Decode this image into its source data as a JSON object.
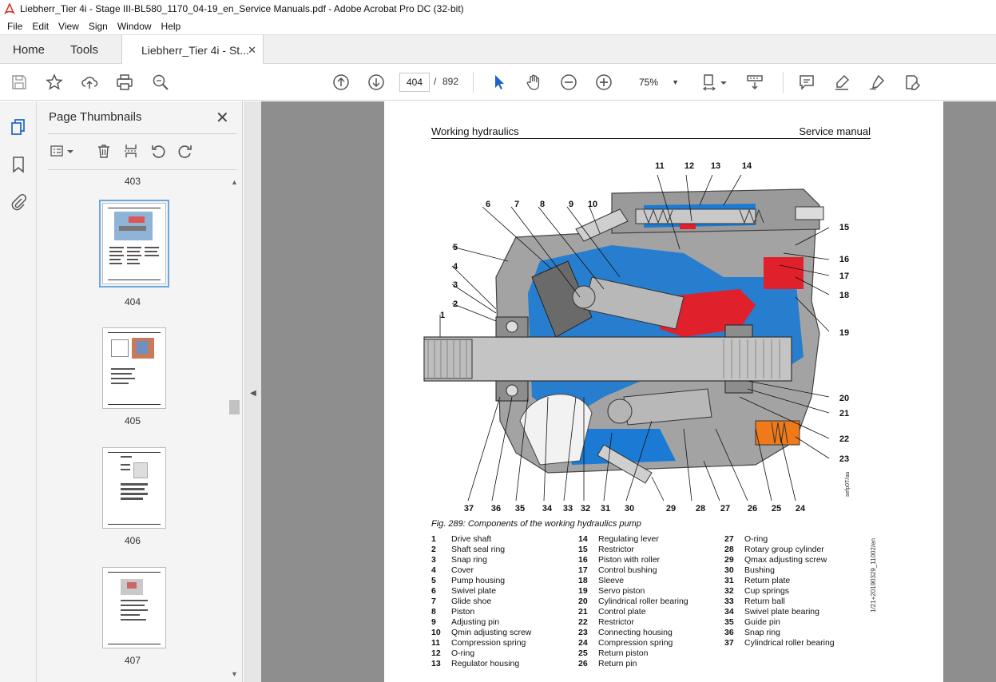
{
  "window": {
    "title": "Liebherr_Tier 4i - Stage III-BL580_1170_04-19_en_Service Manuals.pdf - Adobe Acrobat Pro DC (32-bit)"
  },
  "menu": {
    "items": [
      "File",
      "Edit",
      "View",
      "Sign",
      "Window",
      "Help"
    ]
  },
  "tabs": {
    "home": "Home",
    "tools": "Tools",
    "document": "Liebherr_Tier 4i - St...",
    "close": "✕"
  },
  "toolbar": {
    "current_page": "404",
    "page_separator": "/",
    "total_pages": "892",
    "zoom": "75%"
  },
  "thumbnails_panel": {
    "title": "Page Thumbnails",
    "close": "✕",
    "pages": [
      {
        "label": "403"
      },
      {
        "label": "404",
        "selected": true
      },
      {
        "label": "405"
      },
      {
        "label": "406"
      },
      {
        "label": "407"
      }
    ]
  },
  "document": {
    "header_left": "Working hydraulics",
    "header_right": "Service manual",
    "figure_caption": "Fig. 289: Components of the working hydraulics pump",
    "figure_code": "sefp0T/aa",
    "side_code": "1/21+20190329_11002/en",
    "callouts_top": [
      "11",
      "12",
      "13",
      "14"
    ],
    "callouts_upper": [
      "6",
      "7",
      "8",
      "9",
      "10"
    ],
    "callouts_left": [
      "5",
      "4",
      "3",
      "2",
      "1"
    ],
    "callouts_right": [
      "15",
      "16",
      "17",
      "18",
      "19",
      "20",
      "21",
      "22",
      "23"
    ],
    "callouts_bottom": [
      "37",
      "36",
      "35",
      "34",
      "33",
      "32",
      "31",
      "30",
      "29",
      "28",
      "27",
      "26",
      "25",
      "24"
    ],
    "legend": [
      [
        {
          "num": "1",
          "label": "Drive shaft"
        },
        {
          "num": "2",
          "label": "Shaft seal ring"
        },
        {
          "num": "3",
          "label": "Snap ring"
        },
        {
          "num": "4",
          "label": "Cover"
        },
        {
          "num": "5",
          "label": "Pump housing"
        },
        {
          "num": "6",
          "label": "Swivel plate"
        },
        {
          "num": "7",
          "label": "Glide shoe"
        },
        {
          "num": "8",
          "label": "Piston"
        },
        {
          "num": "9",
          "label": "Adjusting pin"
        },
        {
          "num": "10",
          "label": "Qmin adjusting screw"
        },
        {
          "num": "11",
          "label": "Compression spring"
        },
        {
          "num": "12",
          "label": "O-ring"
        },
        {
          "num": "13",
          "label": "Regulator housing"
        }
      ],
      [
        {
          "num": "14",
          "label": "Regulating lever"
        },
        {
          "num": "15",
          "label": "Restrictor"
        },
        {
          "num": "16",
          "label": "Piston with roller"
        },
        {
          "num": "17",
          "label": "Control bushing"
        },
        {
          "num": "18",
          "label": "Sleeve"
        },
        {
          "num": "19",
          "label": "Servo piston"
        },
        {
          "num": "20",
          "label": "Cylindrical roller bearing"
        },
        {
          "num": "21",
          "label": "Control plate"
        },
        {
          "num": "22",
          "label": "Restrictor"
        },
        {
          "num": "23",
          "label": "Connecting housing"
        },
        {
          "num": "24",
          "label": "Compression spring"
        },
        {
          "num": "25",
          "label": "Return piston"
        },
        {
          "num": "26",
          "label": "Return pin"
        }
      ],
      [
        {
          "num": "27",
          "label": "O-ring"
        },
        {
          "num": "28",
          "label": "Rotary group cylinder"
        },
        {
          "num": "29",
          "label": "Qmax adjusting screw"
        },
        {
          "num": "30",
          "label": "Bushing"
        },
        {
          "num": "31",
          "label": "Return plate"
        },
        {
          "num": "32",
          "label": "Cup springs"
        },
        {
          "num": "33",
          "label": "Return ball"
        },
        {
          "num": "34",
          "label": "Swivel plate bearing"
        },
        {
          "num": "35",
          "label": "Guide pin"
        },
        {
          "num": "36",
          "label": "Snap ring"
        },
        {
          "num": "37",
          "label": "Cylindrical roller bearing"
        }
      ]
    ]
  },
  "icons": {
    "toolbar": [
      "save-icon",
      "bookmark-star-icon",
      "upload-icon",
      "print-icon",
      "search-zoom-icon",
      "page-up-icon",
      "page-down-icon",
      "select-arrow-icon",
      "hand-icon",
      "zoom-out-icon",
      "zoom-in-icon",
      "fit-page-icon",
      "scroll-mode-icon",
      "comment-icon",
      "highlight-icon",
      "sign-icon",
      "share-edit-icon"
    ],
    "rail": [
      "thumbnails-icon",
      "bookmark-icon",
      "attachment-icon"
    ]
  },
  "colors": {
    "accent_blue": "#1f64c8",
    "acrobat_red": "#d42a1e",
    "pump_blue": "#1a7ad4",
    "pump_red": "#e0202a",
    "pump_gray": "#9a9a9a"
  }
}
